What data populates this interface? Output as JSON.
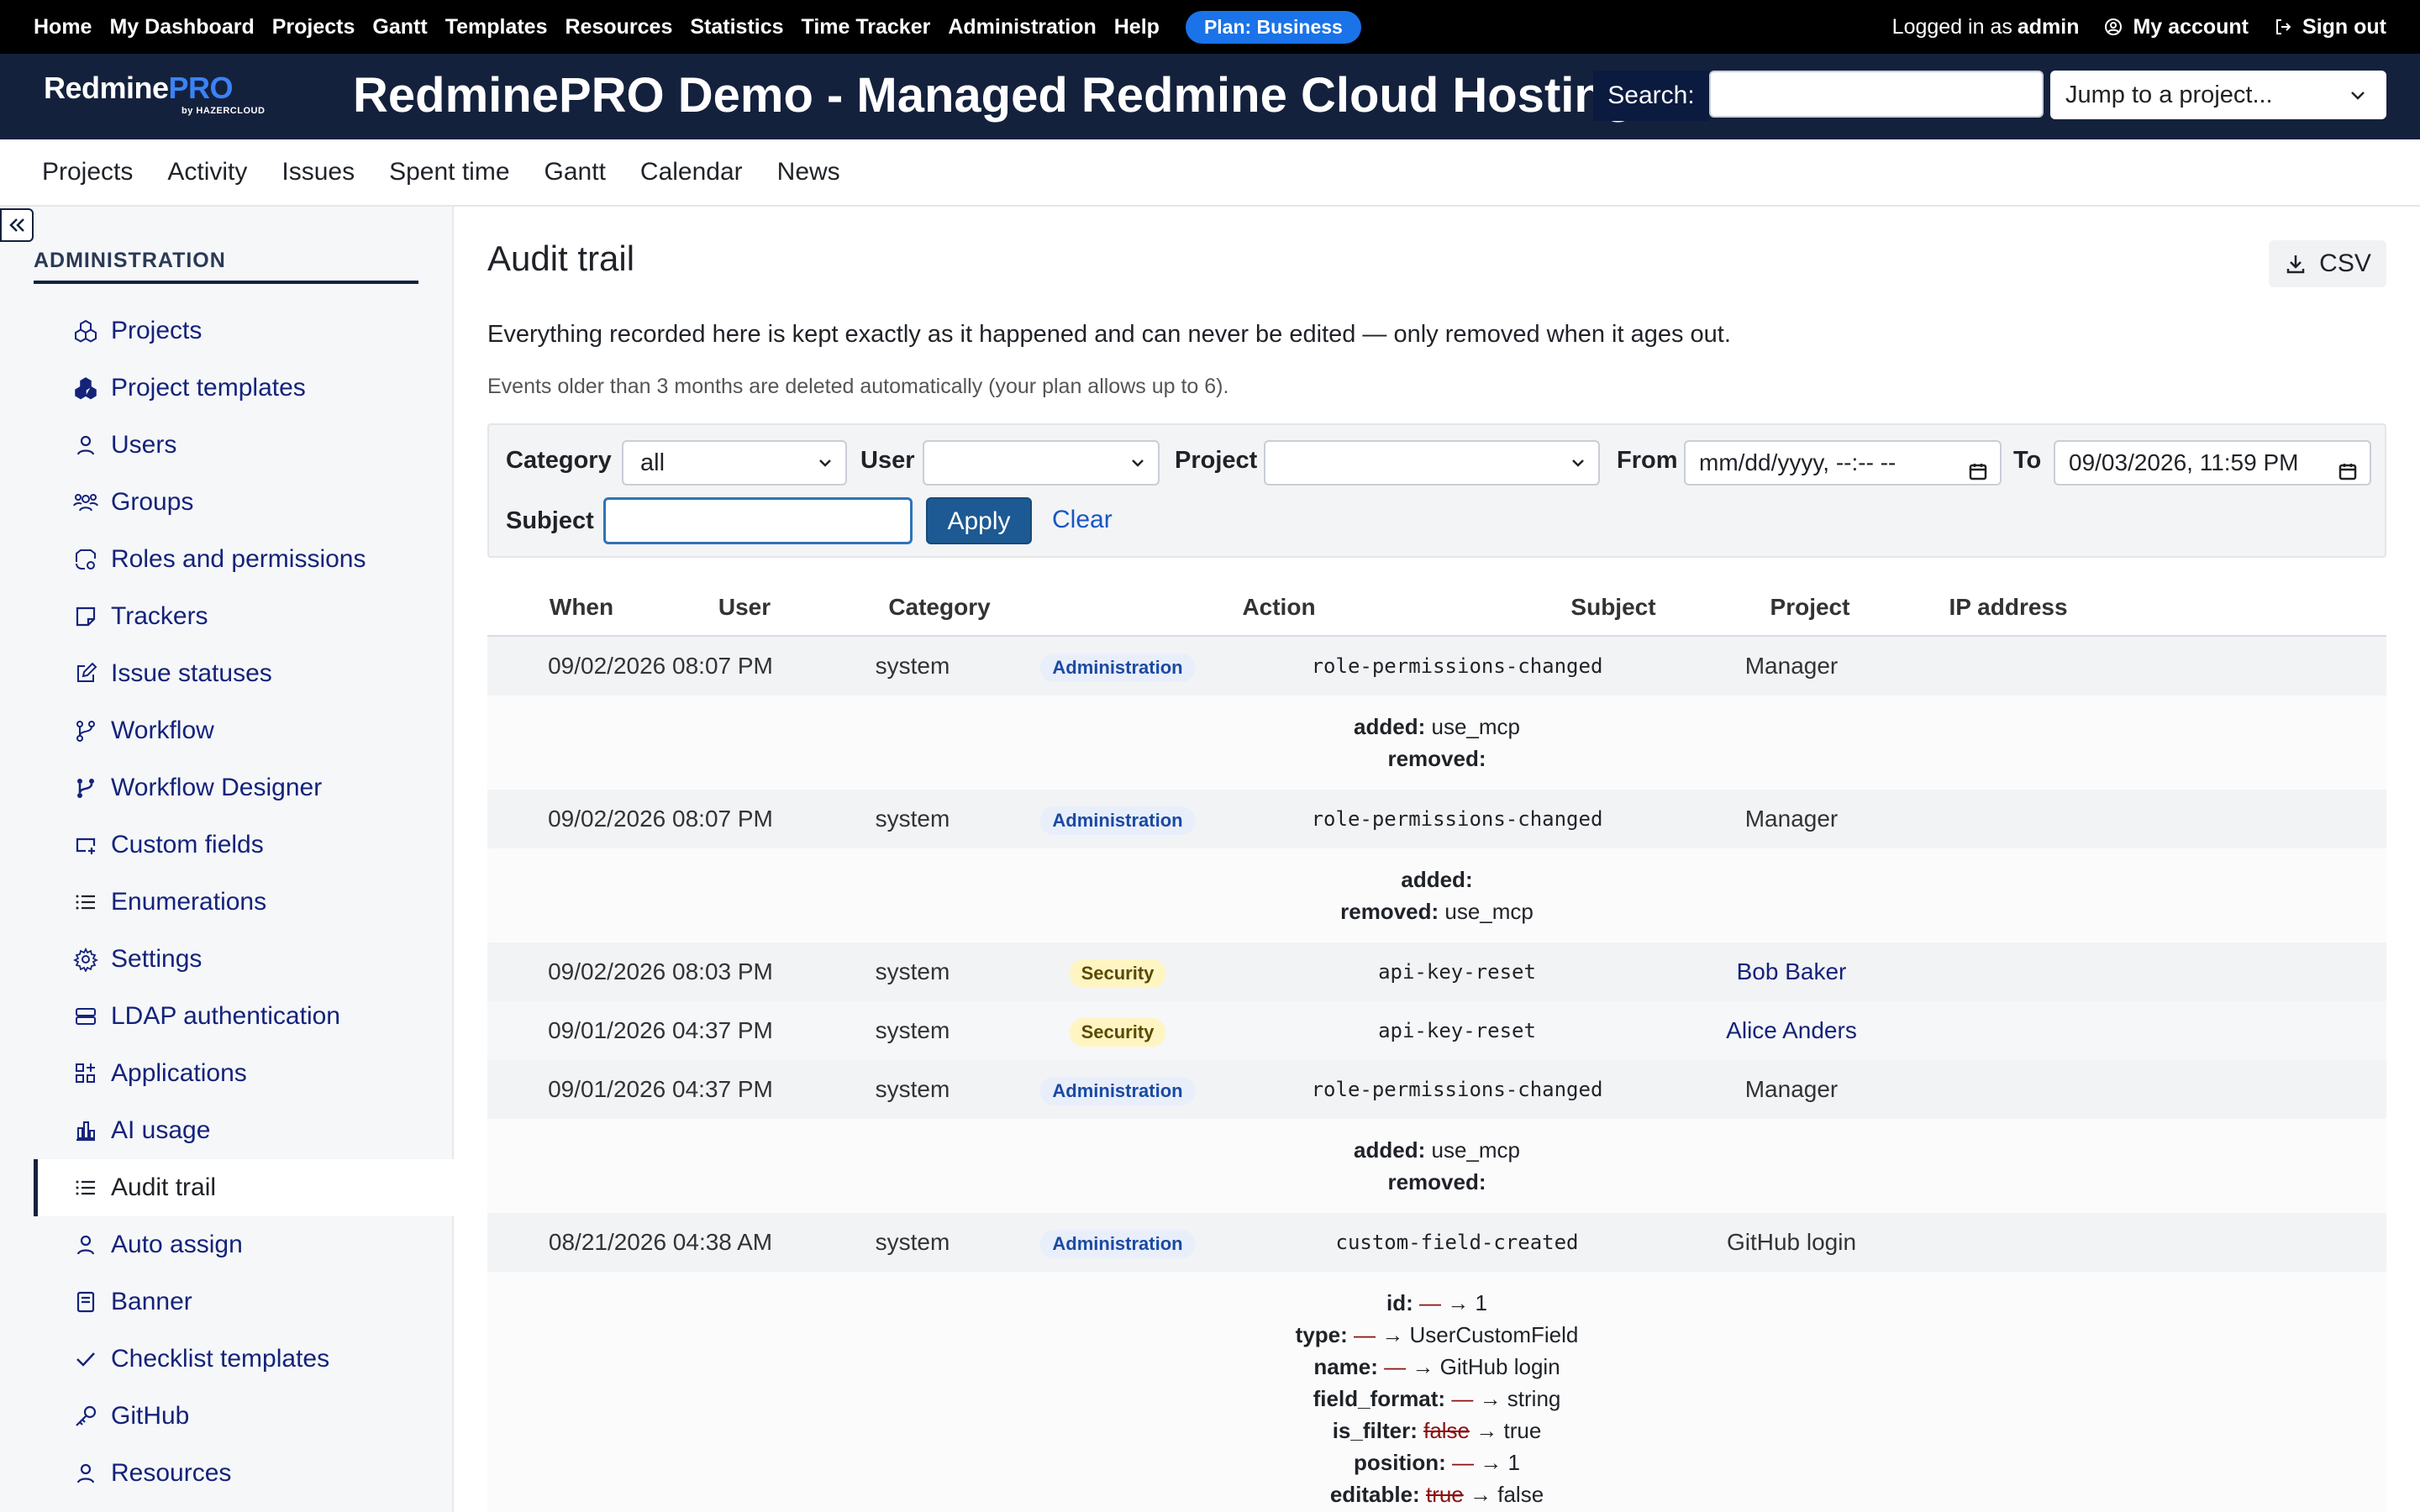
{
  "top_menu": {
    "items": [
      "Home",
      "My Dashboard",
      "Projects",
      "Gantt",
      "Templates",
      "Resources",
      "Statistics",
      "Time Tracker",
      "Administration",
      "Help"
    ],
    "plan_badge": "Plan: Business",
    "logged_in_prefix": "Logged in as",
    "logged_in_user": "admin",
    "my_account": "My account",
    "sign_out": "Sign out"
  },
  "header": {
    "logo_main": "Redmine",
    "logo_pro": "PRO",
    "logo_sub": "by HAZERCLOUD",
    "title": "RedminePRO Demo - Managed Redmine Cloud Hosting",
    "search_label": "Search:",
    "jump_placeholder": "Jump to a project..."
  },
  "main_menu": [
    "Projects",
    "Activity",
    "Issues",
    "Spent time",
    "Gantt",
    "Calendar",
    "News"
  ],
  "sidebar": {
    "heading": "ADMINISTRATION",
    "items": [
      {
        "label": "Projects",
        "icon": "projects-icon"
      },
      {
        "label": "Project templates",
        "icon": "project-templates-icon"
      },
      {
        "label": "Users",
        "icon": "user-icon"
      },
      {
        "label": "Groups",
        "icon": "groups-icon"
      },
      {
        "label": "Roles and permissions",
        "icon": "roles-icon"
      },
      {
        "label": "Trackers",
        "icon": "trackers-icon"
      },
      {
        "label": "Issue statuses",
        "icon": "edit-icon"
      },
      {
        "label": "Workflow",
        "icon": "workflow-icon"
      },
      {
        "label": "Workflow Designer",
        "icon": "workflow-designer-icon"
      },
      {
        "label": "Custom fields",
        "icon": "custom-fields-icon"
      },
      {
        "label": "Enumerations",
        "icon": "list-icon"
      },
      {
        "label": "Settings",
        "icon": "gear-icon"
      },
      {
        "label": "LDAP authentication",
        "icon": "server-icon"
      },
      {
        "label": "Applications",
        "icon": "apps-icon"
      },
      {
        "label": "AI usage",
        "icon": "chart-icon"
      },
      {
        "label": "Audit trail",
        "icon": "list-icon",
        "selected": true
      },
      {
        "label": "Auto assign",
        "icon": "user-icon"
      },
      {
        "label": "Banner",
        "icon": "banner-icon"
      },
      {
        "label": "Checklist templates",
        "icon": "check-icon"
      },
      {
        "label": "GitHub",
        "icon": "key-icon"
      },
      {
        "label": "Resources",
        "icon": "user-icon"
      }
    ]
  },
  "content": {
    "title": "Audit trail",
    "csv_label": "CSV",
    "intro": "Everything recorded here is kept exactly as it happened and can never be edited — only removed when it ages out.",
    "retention": "Events older than 3 months are deleted automatically (your plan allows up to 6).",
    "filters": {
      "category_label": "Category",
      "category_value": "all",
      "user_label": "User",
      "user_value": "",
      "project_label": "Project",
      "project_value": "",
      "from_label": "From",
      "from_value": "mm/dd/yyyy, --:-- --",
      "to_label": "To",
      "to_value": "09/03/2026, 11:59 PM",
      "subject_label": "Subject",
      "apply_label": "Apply",
      "clear_label": "Clear"
    },
    "table": {
      "headers": [
        "When",
        "User",
        "Category",
        "Action",
        "Subject",
        "Project",
        "IP address"
      ],
      "rows": [
        {
          "when": "09/02/2026 08:07 PM",
          "user": "system",
          "category": "Administration",
          "action": "role-permissions-changed",
          "subject": "Manager",
          "project": "",
          "ip": ""
        },
        {
          "when": "09/02/2026 08:07 PM",
          "user": "system",
          "category": "Administration",
          "action": "role-permissions-changed",
          "subject": "Manager",
          "project": "",
          "ip": ""
        },
        {
          "when": "09/02/2026 08:03 PM",
          "user": "system",
          "category": "Security",
          "action": "api-key-reset",
          "subject": "Bob Baker",
          "project": "",
          "ip": ""
        },
        {
          "when": "09/01/2026 04:37 PM",
          "user": "system",
          "category": "Security",
          "action": "api-key-reset",
          "subject": "Alice Anders",
          "project": "",
          "ip": ""
        },
        {
          "when": "09/01/2026 04:37 PM",
          "user": "system",
          "category": "Administration",
          "action": "role-permissions-changed",
          "subject": "Manager",
          "project": "",
          "ip": ""
        },
        {
          "when": "08/21/2026 04:38 AM",
          "user": "system",
          "category": "Administration",
          "action": "custom-field-created",
          "subject": "GitHub login",
          "project": "",
          "ip": ""
        }
      ],
      "details": {
        "d1": {
          "added_key": "added:",
          "added_val": "use_mcp",
          "removed_key": "removed:",
          "removed_val": ""
        },
        "d2": {
          "added_key": "added:",
          "added_val": "",
          "removed_key": "removed:",
          "removed_val": "use_mcp"
        },
        "d5": {
          "added_key": "added:",
          "added_val": "use_mcp",
          "removed_key": "removed:",
          "removed_val": ""
        },
        "d6": [
          {
            "key": "id:",
            "old": "—",
            "new": "1",
            "old_struck": false
          },
          {
            "key": "type:",
            "old": "—",
            "new": "UserCustomField",
            "old_struck": false
          },
          {
            "key": "name:",
            "old": "—",
            "new": "GitHub login",
            "old_struck": false
          },
          {
            "key": "field_format:",
            "old": "—",
            "new": "string",
            "old_struck": false
          },
          {
            "key": "is_filter:",
            "old": "false",
            "new": "true",
            "old_struck": true
          },
          {
            "key": "position:",
            "old": "—",
            "new": "1",
            "old_struck": false
          },
          {
            "key": "editable:",
            "old": "true",
            "new": "false",
            "old_struck": true
          }
        ]
      },
      "arrow": "→"
    }
  },
  "colors": {
    "top_bar": "#000000",
    "header": "#14213d",
    "plan_badge": "#1a73e8",
    "link": "#14237a",
    "apply_button": "#1d5a94",
    "security_badge": "#fff5c2",
    "admin_badge": "#e9eefb",
    "removed_value": "#8b1111"
  }
}
